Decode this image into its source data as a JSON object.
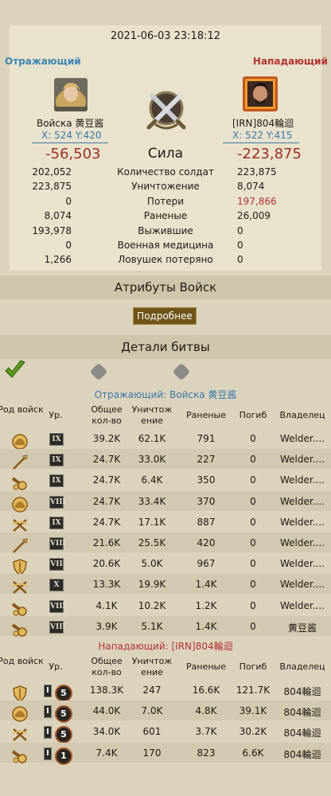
{
  "datetime": "2021-06-03  23:18:12",
  "defender": {
    "side_label": "Отражающий",
    "name": "Войска 黄豆酱",
    "coords": "X: 524 Y:420",
    "power": "-56,503",
    "stats": [
      "202,052",
      "223,875",
      "0",
      "8,074",
      "193,978",
      "0",
      "1,266"
    ],
    "avatar_icon": "blonde-woman-portrait-icon"
  },
  "attacker": {
    "side_label": "Нападающий",
    "name": "[IRN]804輪迴",
    "coords": "X: 522 Y:415",
    "power": "-223,875",
    "stats": [
      "223,875",
      "8,074",
      "197,866",
      "26,009",
      "0",
      "0",
      "0"
    ],
    "avatar_icon": "bearded-man-fire-frame-portrait-icon"
  },
  "power_label": "Сила",
  "stat_labels": [
    "Количество солдат",
    "Уничтожение",
    "Потери",
    "Раненые",
    "Выжившие",
    "Военная медицина",
    "Ловушек потеряно"
  ],
  "troop_attributes": {
    "title": "Атрибуты Войск",
    "details_button": "Подробнее"
  },
  "battle_details": {
    "title": "Детали битвы"
  },
  "columns": [
    "Род войск",
    "Ур.",
    "Общее кол-во",
    "Уничтож ение",
    "Раненые",
    "Погиб",
    "Владелец"
  ],
  "defender_section_title": "Отражающий: Войска 黄豆酱",
  "attacker_section_title": "Нападающий: [IRN]804輪迴",
  "defender_rows": [
    {
      "type_icon": "helmet-icon",
      "tier": "IX",
      "total": "39.2K",
      "kills": "62.1K",
      "wounded": "791",
      "dead": "0",
      "owner": "Welder...."
    },
    {
      "type_icon": "spear-icon",
      "tier": "IX",
      "total": "24.7K",
      "kills": "33.0K",
      "wounded": "227",
      "dead": "0",
      "owner": "Welder...."
    },
    {
      "type_icon": "cannon-icon",
      "tier": "IX",
      "total": "24.7K",
      "kills": "6.4K",
      "wounded": "350",
      "dead": "0",
      "owner": "Welder...."
    },
    {
      "type_icon": "helmet-icon",
      "tier": "VIII",
      "total": "24.7K",
      "kills": "33.4K",
      "wounded": "370",
      "dead": "0",
      "owner": "Welder...."
    },
    {
      "type_icon": "crossbow-icon",
      "tier": "IX",
      "total": "24.7K",
      "kills": "17.1K",
      "wounded": "887",
      "dead": "0",
      "owner": "Welder...."
    },
    {
      "type_icon": "spear-icon",
      "tier": "VIII",
      "total": "21.6K",
      "kills": "25.5K",
      "wounded": "420",
      "dead": "0",
      "owner": "Welder...."
    },
    {
      "type_icon": "shield-icon",
      "tier": "VII",
      "total": "20.6K",
      "kills": "5.0K",
      "wounded": "967",
      "dead": "0",
      "owner": "Welder...."
    },
    {
      "type_icon": "crossbow-icon",
      "tier": "X",
      "total": "13.3K",
      "kills": "19.9K",
      "wounded": "1.4K",
      "dead": "0",
      "owner": "Welder...."
    },
    {
      "type_icon": "cannon-icon",
      "tier": "VIII",
      "total": "4.1K",
      "kills": "10.2K",
      "wounded": "1.2K",
      "dead": "0",
      "owner": "Welder...."
    },
    {
      "type_icon": "cannon-icon",
      "tier": "VIII",
      "total": "3.9K",
      "kills": "5.1K",
      "wounded": "1.4K",
      "dead": "0",
      "owner": "黄豆酱"
    }
  ],
  "attacker_rows": [
    {
      "type_icon": "shield-icon",
      "level": "I",
      "star": "5",
      "total": "138.3K",
      "kills": "247",
      "wounded": "16.6K",
      "dead": "121.7K",
      "owner": "804輪迴"
    },
    {
      "type_icon": "helmet-icon",
      "level": "I",
      "star": "5",
      "total": "44.0K",
      "kills": "7.0K",
      "wounded": "4.8K",
      "dead": "39.1K",
      "owner": "804輪迴"
    },
    {
      "type_icon": "crossbow-icon",
      "level": "I",
      "star": "5",
      "total": "34.0K",
      "kills": "601",
      "wounded": "3.7K",
      "dead": "30.2K",
      "owner": "804輪迴"
    },
    {
      "type_icon": "cannon-icon",
      "level": "I",
      "star": "1",
      "total": "7.4K",
      "kills": "170",
      "wounded": "823",
      "dead": "6.6K",
      "owner": "804輪迴"
    }
  ],
  "colors": {
    "power": "#9c2f23",
    "defender": "#3a78a8",
    "attacker": "#b23232",
    "losses": "#b23232",
    "button": "#6e5418"
  }
}
